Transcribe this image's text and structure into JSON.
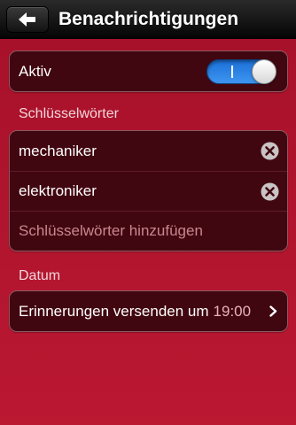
{
  "nav": {
    "title": "Benachrichtigungen",
    "back_icon": "arrow-left-icon"
  },
  "active": {
    "label": "Aktiv",
    "toggle_on": true,
    "toggle_color": "#3f96f0"
  },
  "keywords": {
    "header": "Schlüsselwörter",
    "items": [
      {
        "label": "mechaniker"
      },
      {
        "label": "elektroniker"
      }
    ],
    "add_label": "Schlüsselwörter hinzufügen"
  },
  "date": {
    "header": "Datum",
    "reminder_label": "Erinnerungen versenden um",
    "reminder_time": "19:00"
  },
  "colors": {
    "background": "#b0142c",
    "cell": "#410710"
  }
}
